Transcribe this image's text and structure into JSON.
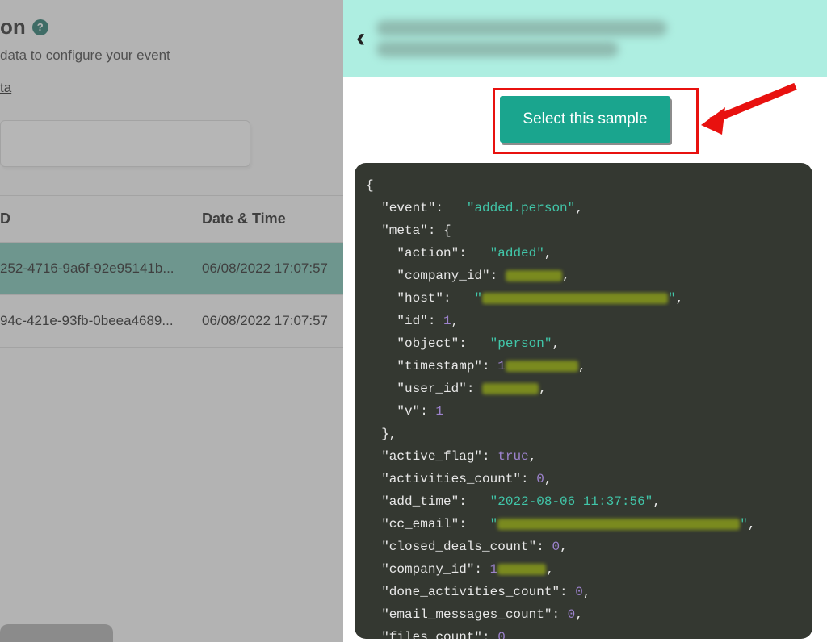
{
  "left": {
    "title_fragment": "on",
    "subtitle": " data to configure your event",
    "link_text": "ta",
    "col_id_header_fragment": "D",
    "col_datetime_header": "Date & Time",
    "rows": [
      {
        "id_fragment": "252-4716-9a6f-92e95141b...",
        "datetime": "06/08/2022 17:07:57"
      },
      {
        "id_fragment": "94c-421e-93fb-0beea4689...",
        "datetime": "06/08/2022 17:07:57"
      }
    ]
  },
  "right": {
    "select_button_label": "Select this sample",
    "code": {
      "event": "added.person",
      "meta_action": "added",
      "meta_company_id_redacted": true,
      "meta_host_redacted": true,
      "meta_id": 1,
      "meta_object": "person",
      "meta_timestamp_prefix": "1",
      "meta_user_id_redacted": true,
      "meta_v": 1,
      "active_flag": "true",
      "activities_count": 0,
      "add_time": "2022-08-06 11:37:56",
      "cc_email_redacted": true,
      "closed_deals_count": 0,
      "company_id_prefix": "1",
      "done_activities_count": 0,
      "email_messages_count": 0,
      "files_count": 0
    }
  }
}
